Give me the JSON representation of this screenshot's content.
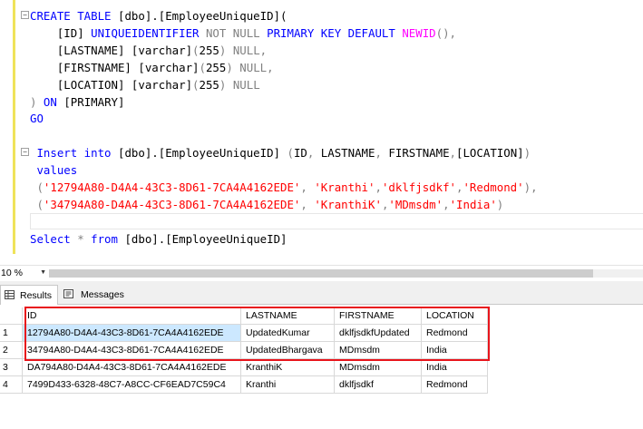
{
  "editor": {
    "lines": [
      [
        {
          "t": "CREATE TABLE ",
          "c": "kw"
        },
        {
          "t": "[dbo].[EmployeeUniqueID](",
          "c": "tx"
        }
      ],
      [
        {
          "t": "    [ID] ",
          "c": "tx"
        },
        {
          "t": "UNIQUEIDENTIFIER ",
          "c": "kw"
        },
        {
          "t": "NOT NULL ",
          "c": "gy"
        },
        {
          "t": "PRIMARY KEY DEFAULT ",
          "c": "kw"
        },
        {
          "t": "NEWID",
          "c": "fn"
        },
        {
          "t": "(),",
          "c": "gy"
        }
      ],
      [
        {
          "t": "    [LASTNAME] [varchar]",
          "c": "tx"
        },
        {
          "t": "(",
          "c": "gy"
        },
        {
          "t": "255",
          "c": "tx"
        },
        {
          "t": ") NULL,",
          "c": "gy"
        }
      ],
      [
        {
          "t": "    [FIRSTNAME] [varchar]",
          "c": "tx"
        },
        {
          "t": "(",
          "c": "gy"
        },
        {
          "t": "255",
          "c": "tx"
        },
        {
          "t": ") NULL,",
          "c": "gy"
        }
      ],
      [
        {
          "t": "    [LOCATION] [varchar]",
          "c": "tx"
        },
        {
          "t": "(",
          "c": "gy"
        },
        {
          "t": "255",
          "c": "tx"
        },
        {
          "t": ") NULL",
          "c": "gy"
        }
      ],
      [
        {
          "t": ") ",
          "c": "gy"
        },
        {
          "t": "ON ",
          "c": "kw"
        },
        {
          "t": "[PRIMARY]",
          "c": "tx"
        }
      ],
      [
        {
          "t": "GO",
          "c": "kw"
        }
      ],
      [],
      [
        {
          "t": " Insert into ",
          "c": "kw"
        },
        {
          "t": "[dbo].[EmployeeUniqueID] ",
          "c": "tx"
        },
        {
          "t": "(",
          "c": "gy"
        },
        {
          "t": "ID",
          "c": "tx"
        },
        {
          "t": ", ",
          "c": "gy"
        },
        {
          "t": "LASTNAME",
          "c": "tx"
        },
        {
          "t": ", ",
          "c": "gy"
        },
        {
          "t": "FIRSTNAME",
          "c": "tx"
        },
        {
          "t": ",",
          "c": "gy"
        },
        {
          "t": "[LOCATION]",
          "c": "tx"
        },
        {
          "t": ")",
          "c": "gy"
        }
      ],
      [
        {
          "t": " values",
          "c": "kw"
        }
      ],
      [
        {
          "t": " (",
          "c": "gy"
        },
        {
          "t": "'12794A80-D4A4-43C3-8D61-7CA4A4162EDE'",
          "c": "st"
        },
        {
          "t": ", ",
          "c": "gy"
        },
        {
          "t": "'Kranthi'",
          "c": "st"
        },
        {
          "t": ",",
          "c": "gy"
        },
        {
          "t": "'dklfjsdkf'",
          "c": "st"
        },
        {
          "t": ",",
          "c": "gy"
        },
        {
          "t": "'Redmond'",
          "c": "st"
        },
        {
          "t": "),",
          "c": "gy"
        }
      ],
      [
        {
          "t": " (",
          "c": "gy"
        },
        {
          "t": "'34794A80-D4A4-43C3-8D61-7CA4A4162EDE'",
          "c": "st"
        },
        {
          "t": ", ",
          "c": "gy"
        },
        {
          "t": "'KranthiK'",
          "c": "st"
        },
        {
          "t": ",",
          "c": "gy"
        },
        {
          "t": "'MDmsdm'",
          "c": "st"
        },
        {
          "t": ",",
          "c": "gy"
        },
        {
          "t": "'India'",
          "c": "st"
        },
        {
          "t": ")",
          "c": "gy"
        }
      ],
      [],
      [
        {
          "t": "Select ",
          "c": "kw"
        },
        {
          "t": "* ",
          "c": "gy"
        },
        {
          "t": "from ",
          "c": "kw"
        },
        {
          "t": "[dbo].[EmployeeUniqueID]",
          "c": "tx"
        }
      ]
    ]
  },
  "zoom": {
    "value": "10 %"
  },
  "tabs": {
    "results": "Results",
    "messages": "Messages"
  },
  "grid": {
    "columns": [
      "ID",
      "LASTNAME",
      "FIRSTNAME",
      "LOCATION"
    ],
    "rows": [
      {
        "n": "1",
        "cells": [
          "12794A80-D4A4-43C3-8D61-7CA4A4162EDE",
          "UpdatedKumar",
          "dklfjsdkfUpdated",
          "Redmond"
        ]
      },
      {
        "n": "2",
        "cells": [
          "34794A80-D4A4-43C3-8D61-7CA4A4162EDE",
          "UpdatedBhargava",
          "MDmsdm",
          "India"
        ]
      },
      {
        "n": "3",
        "cells": [
          "DA794A80-D4A4-43C3-8D61-7CA4A4162EDE",
          "KranthiK",
          "MDmsdm",
          "India"
        ]
      },
      {
        "n": "4",
        "cells": [
          "7499D433-6328-48C7-A8CC-CF6EAD7C59C4",
          "Kranthi",
          "dklfjsdkf",
          "Redmond"
        ]
      }
    ]
  },
  "colors": {
    "highlight": "#e8141b",
    "selected_cell": "#cce8ff",
    "keyword": "#0000ff",
    "string": "#ff0000",
    "function": "#ff00ff",
    "operator": "#808080"
  }
}
